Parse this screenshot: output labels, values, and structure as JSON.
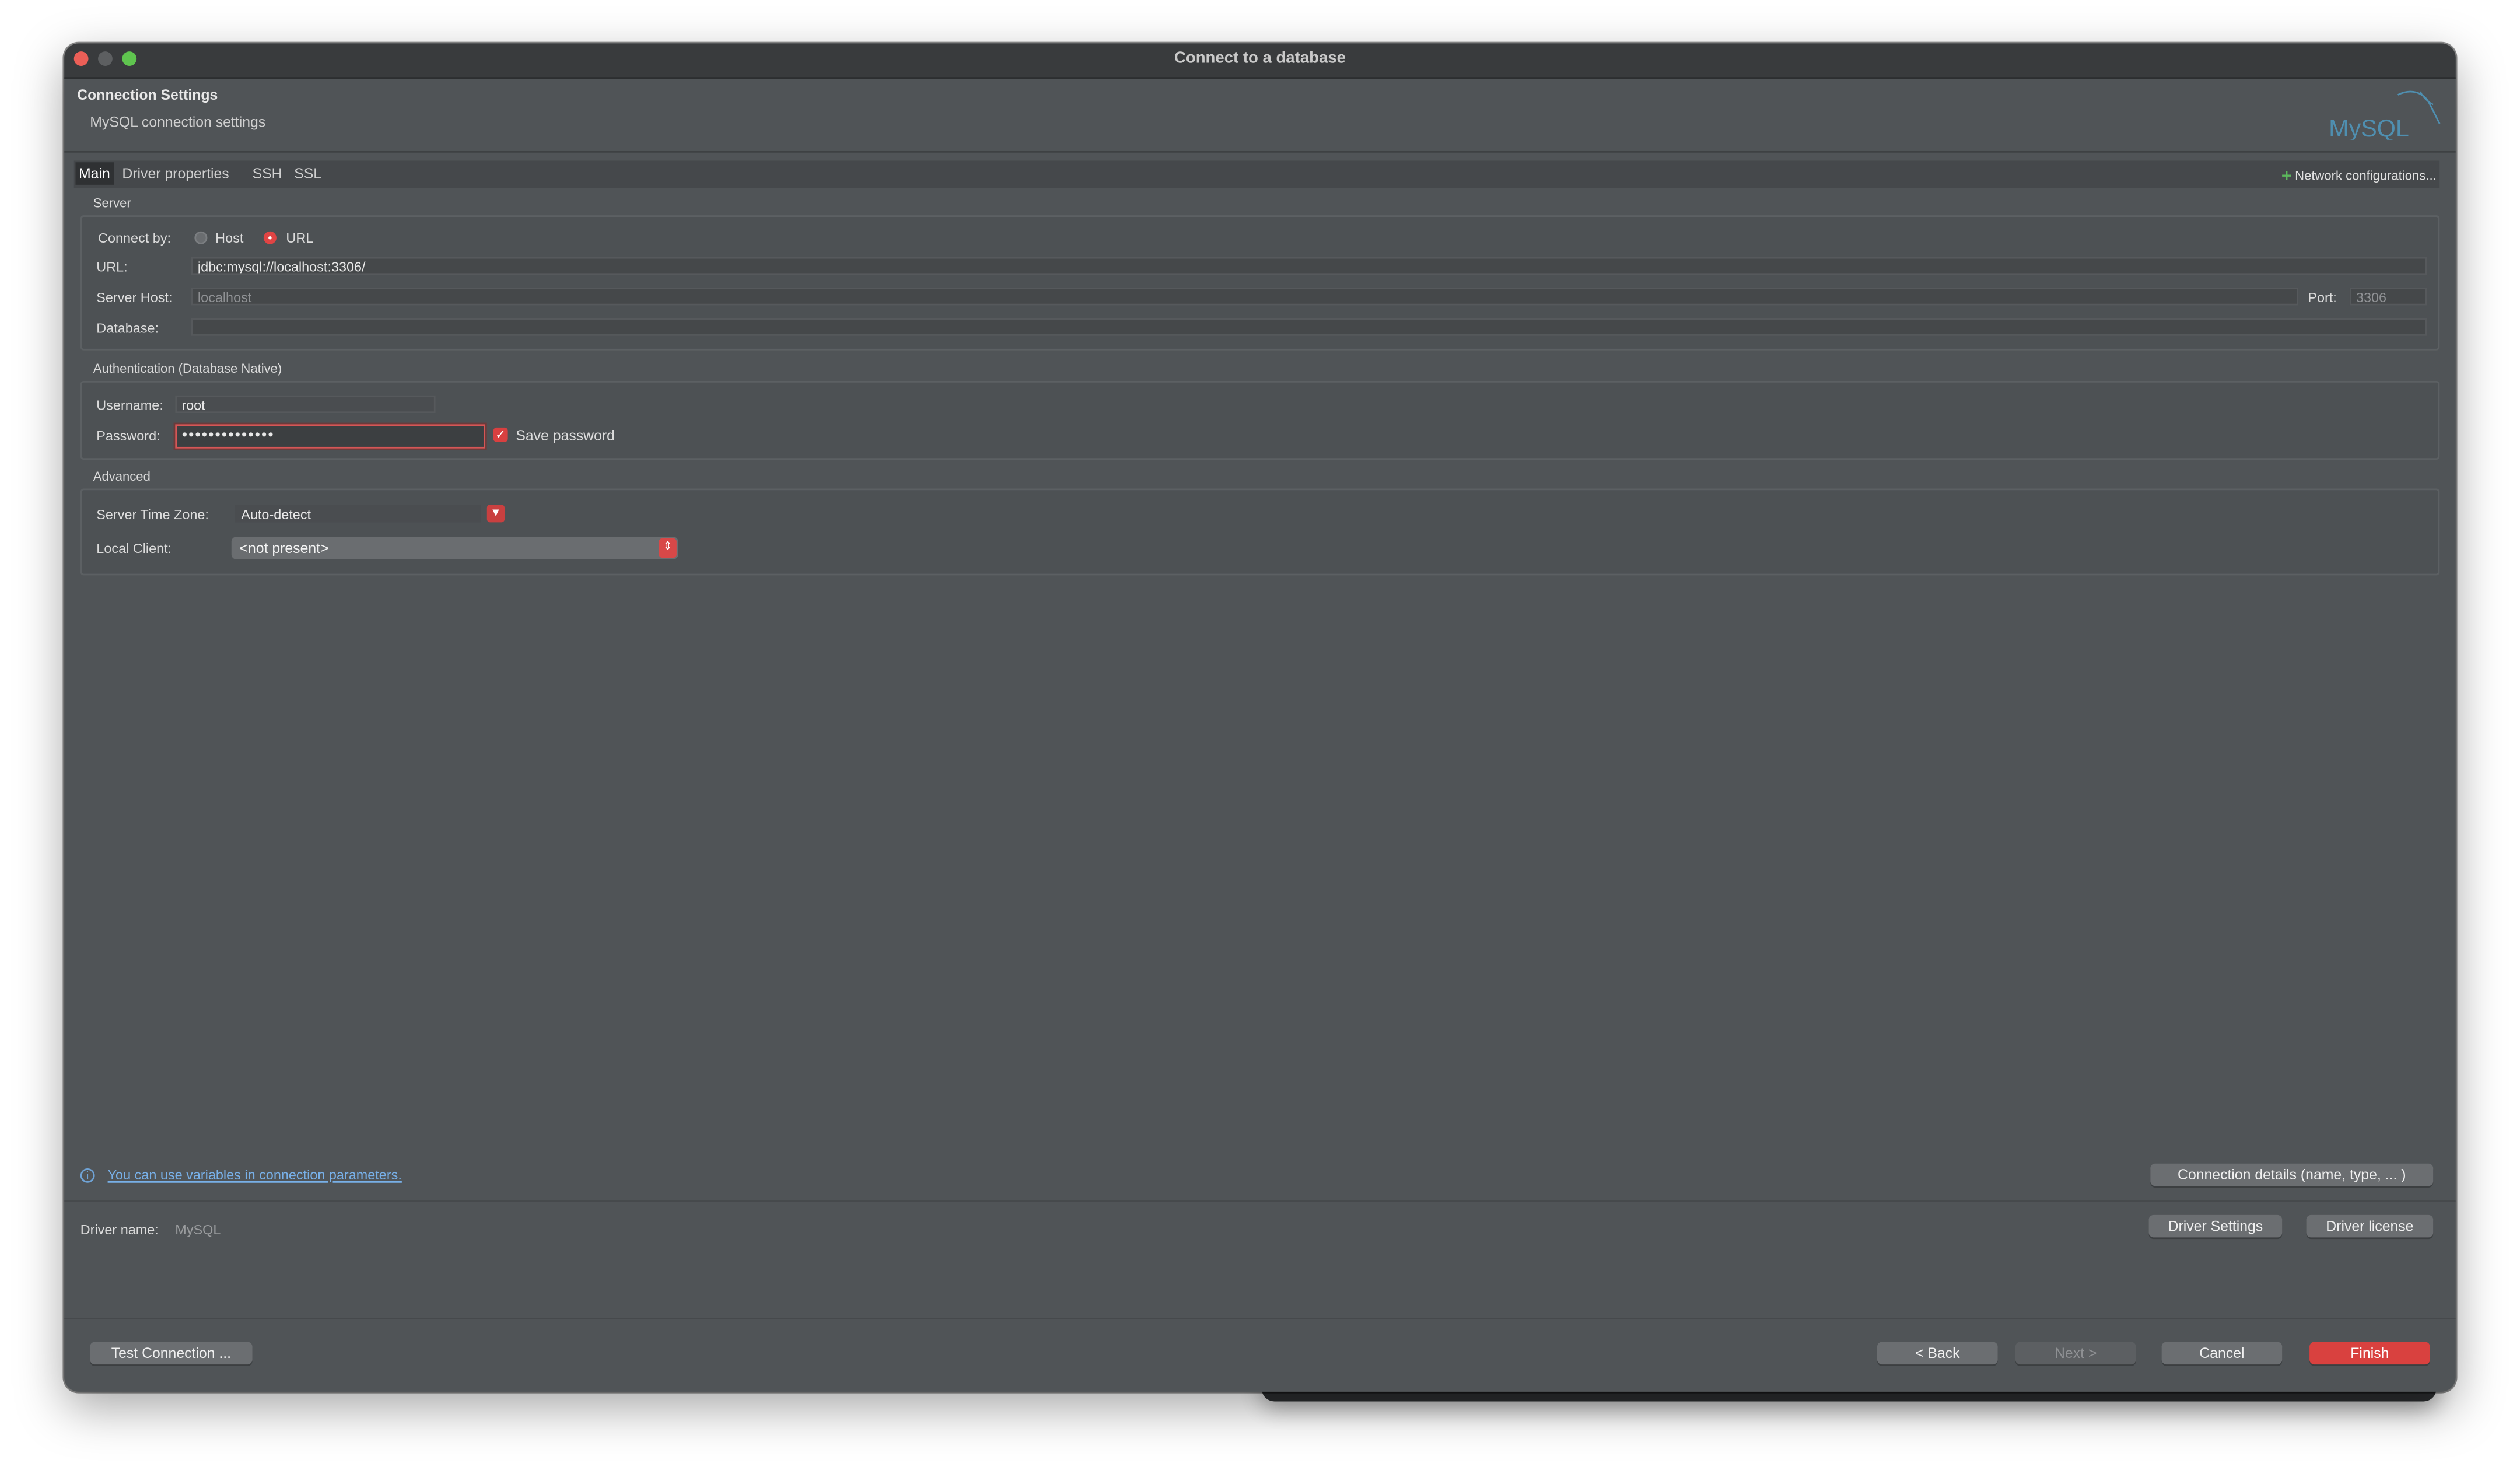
{
  "window": {
    "title": "Connect to a database"
  },
  "header": {
    "title": "Connection Settings",
    "subtitle": "MySQL connection settings",
    "logo_text": "MySQL"
  },
  "tabs": [
    {
      "label": "Main",
      "active": true
    },
    {
      "label": "Driver properties"
    },
    {
      "label": "SSH"
    },
    {
      "label": "SSL"
    }
  ],
  "network_config": {
    "label": "Network configurations..."
  },
  "server": {
    "section": "Server",
    "connect_by_label": "Connect by:",
    "host_option": "Host",
    "url_option": "URL",
    "selected": "URL",
    "url_label": "URL:",
    "url_value": "jdbc:mysql://localhost:3306/",
    "host_label": "Server Host:",
    "host_placeholder": "localhost",
    "port_label": "Port:",
    "port_placeholder": "3306",
    "database_label": "Database:",
    "database_value": ""
  },
  "auth": {
    "section": "Authentication (Database Native)",
    "username_label": "Username:",
    "username_value": "root",
    "password_label": "Password:",
    "password_masked": "●●●●●●●●●●●●●●",
    "save_password_label": "Save password",
    "save_password_checked": true
  },
  "advanced": {
    "section": "Advanced",
    "timezone_label": "Server Time Zone:",
    "timezone_value": "Auto-detect",
    "local_client_label": "Local Client:",
    "local_client_value": "<not present>"
  },
  "footer": {
    "info_link": "You can use variables in connection parameters.",
    "connection_details": "Connection details (name, type, ... )",
    "driver_name_label": "Driver name:",
    "driver_name_value": "MySQL",
    "driver_settings": "Driver Settings",
    "driver_license": "Driver license",
    "test_connection": "Test Connection ...",
    "back": "< Back",
    "next": "Next >",
    "cancel": "Cancel",
    "finish": "Finish"
  },
  "colors": {
    "accent": "#d9413f",
    "link": "#78b0e8",
    "background": "#505457"
  }
}
